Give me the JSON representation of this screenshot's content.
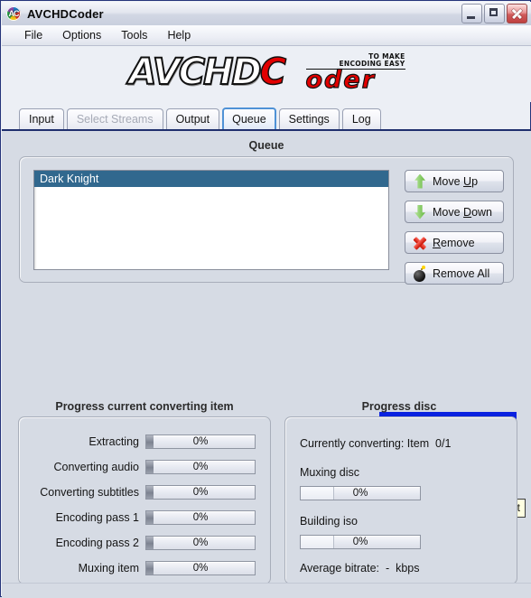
{
  "window": {
    "title": "AVCHDCoder",
    "icon": "app-icon",
    "controls": {
      "minimize": "minimize",
      "maximize": "maximize",
      "close": "close"
    }
  },
  "menu": {
    "items": [
      "File",
      "Options",
      "Tools",
      "Help"
    ]
  },
  "logo": {
    "part1": "AVCHD",
    "part2": "C",
    "part3": "oder",
    "tagline_line1": "TO MAKE",
    "tagline_line2": "ENCODING EASY"
  },
  "tabs": [
    {
      "label": "Input",
      "state": "normal"
    },
    {
      "label": "Select Streams",
      "state": "disabled"
    },
    {
      "label": "Output",
      "state": "normal"
    },
    {
      "label": "Queue",
      "state": "active"
    },
    {
      "label": "Settings",
      "state": "normal"
    },
    {
      "label": "Log",
      "state": "normal"
    }
  ],
  "queue": {
    "caption": "Queue",
    "items": [
      {
        "label": "Dark Knight",
        "selected": true
      }
    ],
    "buttons": [
      {
        "label_pre": "Move ",
        "accel": "U",
        "label_post": "p",
        "icon": "arrow-up-icon"
      },
      {
        "label_pre": "Move ",
        "accel": "D",
        "label_post": "own",
        "icon": "arrow-down-icon"
      },
      {
        "label_pre": "",
        "accel": "R",
        "label_post": "emove",
        "icon": "remove-x-icon"
      },
      {
        "label_pre": "Remove All",
        "accel": "",
        "label_post": "",
        "icon": "bomb-icon"
      }
    ],
    "convert_button": {
      "icon": "refresh-icon",
      "tooltip": "Convert"
    }
  },
  "progress_item": {
    "caption": "Progress current converting item",
    "rows": [
      {
        "label": "Extracting",
        "value": "0%"
      },
      {
        "label": "Converting audio",
        "value": "0%"
      },
      {
        "label": "Converting subtitles",
        "value": "0%"
      },
      {
        "label": "Encoding pass 1",
        "value": "0%"
      },
      {
        "label": "Encoding pass 2",
        "value": "0%"
      },
      {
        "label": "Muxing item",
        "value": "0%"
      }
    ]
  },
  "progress_disc": {
    "caption": "Progress disc",
    "currently_converting": "Currently converting: Item  0/1",
    "muxing_label": "Muxing disc",
    "muxing_value": "0%",
    "building_label": "Building iso",
    "building_value": "0%",
    "average_bitrate": "Average bitrate:  -  kbps"
  },
  "colors": {
    "selection": "#31688E",
    "highlight_box": "#0A22E0",
    "tooltip_bg": "#FFFFE1",
    "logo_red": "#E10000",
    "tab_active_border": "#4F92D6"
  }
}
